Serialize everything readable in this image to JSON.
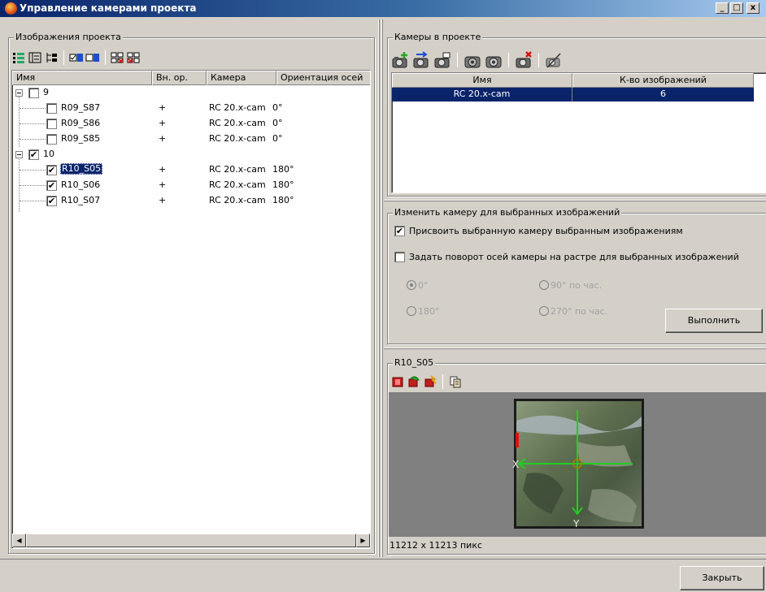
{
  "window": {
    "title": "Управление камерами проекта",
    "minimize_glyph": "_",
    "maximize_glyph": "□",
    "close_glyph": "x"
  },
  "images_panel": {
    "legend": "Изображения проекта",
    "toolbar_icons": [
      "expand-all-icon",
      "collapse-all-icon",
      "expand-levels-icon",
      "select-images-icon",
      "deselect-images-icon",
      "check-all-icon",
      "uncheck-all-icon"
    ],
    "columns": [
      "Имя",
      "Вн. ор.",
      "Камера",
      "Ориентация осей"
    ],
    "groups": [
      {
        "name": "9",
        "checked": false,
        "expanded": true,
        "items": [
          {
            "name": "R09_S87",
            "inner": "+",
            "camera": "RC 20.x-cam",
            "orientation": "0°",
            "checked": false,
            "selected": false
          },
          {
            "name": "R09_S86",
            "inner": "+",
            "camera": "RC 20.x-cam",
            "orientation": "0°",
            "checked": false,
            "selected": false
          },
          {
            "name": "R09_S85",
            "inner": "+",
            "camera": "RC 20.x-cam",
            "orientation": "0°",
            "checked": false,
            "selected": false
          }
        ]
      },
      {
        "name": "10",
        "checked": true,
        "expanded": true,
        "items": [
          {
            "name": "R10_S05",
            "inner": "+",
            "camera": "RC 20.x-cam",
            "orientation": "180°",
            "checked": true,
            "selected": true
          },
          {
            "name": "R10_S06",
            "inner": "+",
            "camera": "RC 20.x-cam",
            "orientation": "180°",
            "checked": true,
            "selected": false
          },
          {
            "name": "R10_S07",
            "inner": "+",
            "camera": "RC 20.x-cam",
            "orientation": "180°",
            "checked": true,
            "selected": false
          }
        ]
      }
    ],
    "check_glyph": "✔",
    "scroll_left_glyph": "◀",
    "scroll_right_glyph": "▶"
  },
  "cameras_panel": {
    "legend": "Камеры в проекте",
    "toolbar_icons": [
      "add-camera-icon",
      "import-camera-icon",
      "edit-camera-icon",
      "camera-properties-icon",
      "camera-settings-icon",
      "delete-camera-icon",
      "camera-disable-icon"
    ],
    "columns": [
      "Имя",
      "К-во изображений"
    ],
    "rows": [
      {
        "name": "RC 20.x-cam",
        "count": "6",
        "selected": true
      }
    ]
  },
  "change_camera_panel": {
    "legend": "Изменить камеру для выбранных изображений",
    "assign_label": "Присвоить выбранную камеру выбранным изображениям",
    "assign_checked": true,
    "rotation_label": "Задать поворот осей камеры на растре для выбранных изображений",
    "rotation_checked": false,
    "radios": [
      {
        "label": "0°",
        "selected": true
      },
      {
        "label": "90° по час.",
        "selected": false
      },
      {
        "label": "180°",
        "selected": false
      },
      {
        "label": "270° по час.",
        "selected": false
      }
    ],
    "execute_button": "Выполнить"
  },
  "preview_panel": {
    "legend": "R10_S05",
    "toolbar_icons": [
      "rotate-left-icon",
      "rotate-right-icon",
      "flip-icon",
      "copy-icon"
    ],
    "axis_x": "X",
    "axis_y": "Y",
    "size_text": "11212 x 11213 пикс"
  },
  "footer": {
    "close_button": "Закрыть"
  },
  "colors": {
    "selection": "#0a246a",
    "title_gradient_start": "#0a246a",
    "title_gradient_end": "#a6caf0",
    "preview_background": "#808080",
    "axis_green": "#22cc22",
    "axis_red": "#e01010"
  }
}
